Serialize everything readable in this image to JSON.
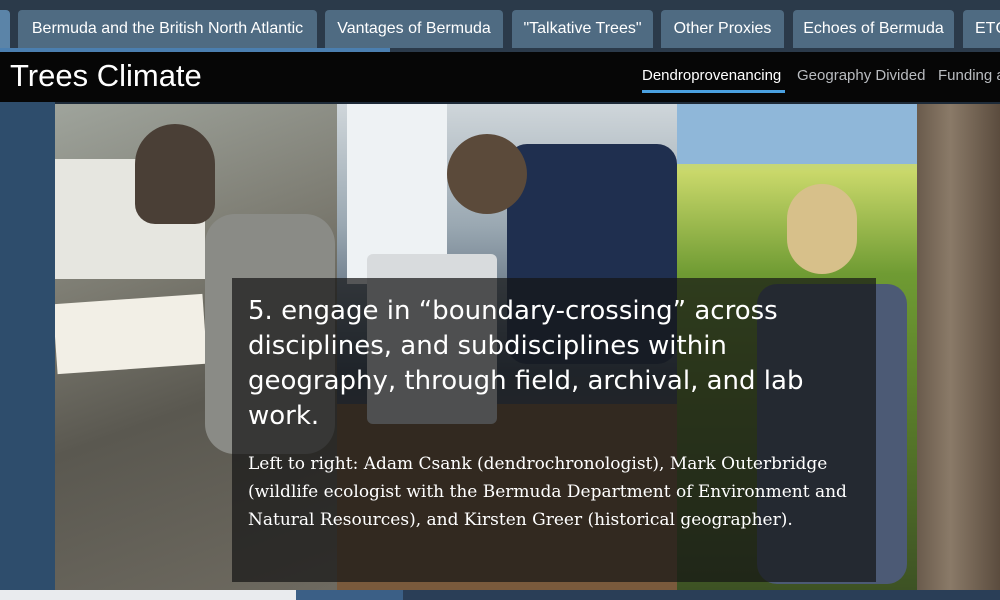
{
  "tabs": [
    {
      "label": ""
    },
    {
      "label": "Bermuda and the British North Atlantic"
    },
    {
      "label": "Vantages of Bermuda"
    },
    {
      "label": "\"Talkative Trees\""
    },
    {
      "label": "Other Proxies"
    },
    {
      "label": "Echoes of Bermuda"
    },
    {
      "label": "ETC"
    }
  ],
  "header": {
    "site_title": "Trees Climate",
    "nav": [
      {
        "label": "Dendroprovenancing",
        "active": true
      },
      {
        "label": "Geography Divided",
        "active": false
      },
      {
        "label": "Funding a",
        "active": false
      }
    ]
  },
  "slide": {
    "heading": "5. engage in “boundary-crossing” across disciplines, and subdisciplines within geography, through field, archival, and lab work.",
    "caption": "Left to right: Adam Csank (dendrochronologist), Mark Outerbridge (wildlife ecologist with the Bermuda Department of Environment and Natural Resources), and Kirsten Greer (historical geographer)."
  },
  "colors": {
    "tab_bg": "#4f6b82",
    "tab_strip_bg": "#2b3a4a",
    "header_bg": "#060606",
    "nav_underline": "#4aa0e0",
    "overlay_bg": "rgba(20,20,20,0.70)"
  }
}
